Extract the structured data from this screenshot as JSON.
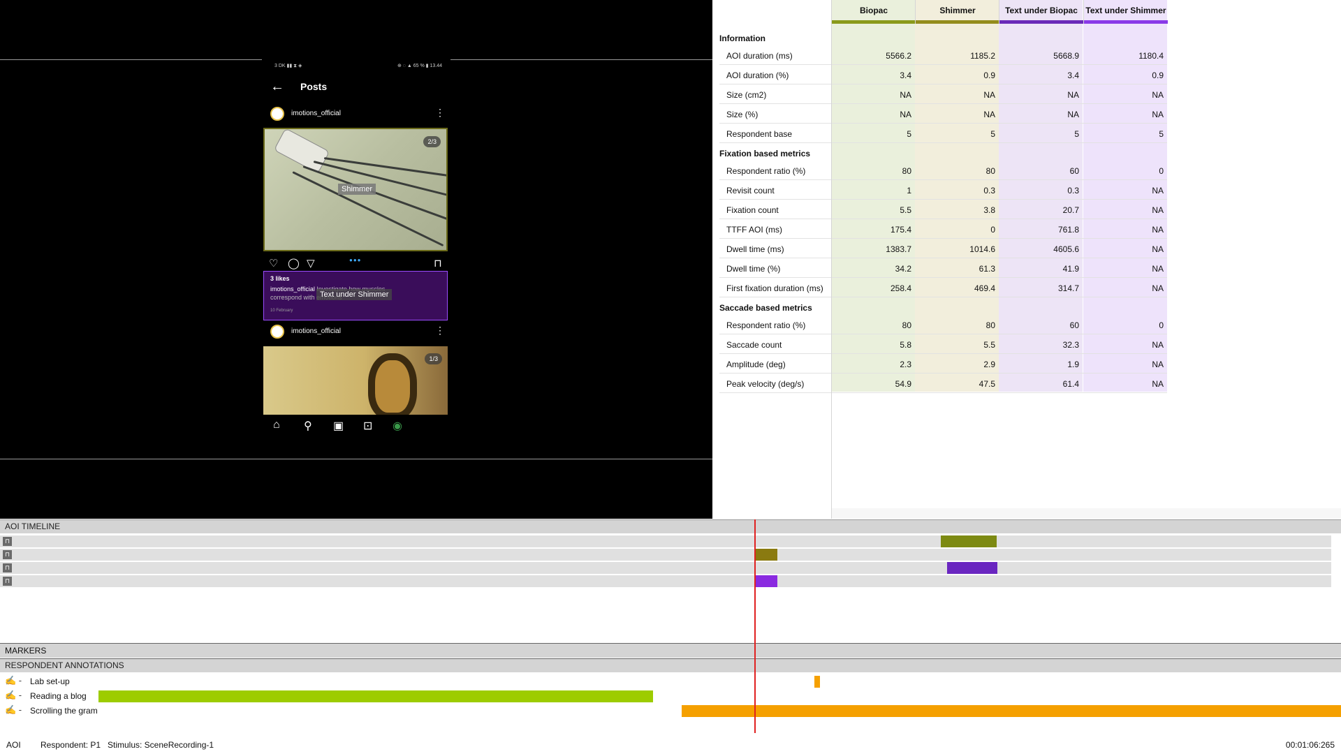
{
  "phone": {
    "status_left": "3 DK ▮▮ ⧗ ◈",
    "status_right": "⊕ ◌ ▲ 65 % ▮ 13.44",
    "header_title": "Posts",
    "posts": [
      {
        "username": "imotions_official",
        "counter": "2/3",
        "aoi_label": "Shimmer"
      },
      {
        "username": "imotions_official",
        "counter": "1/3"
      }
    ],
    "likes": "3 likes",
    "caption_user": "imotions_official",
    "caption_text": " Investigate how muscles correspond with emotions",
    "caption_date": "10 February",
    "caption_aoi_label": "Text under Shimmer"
  },
  "table": {
    "columns": [
      "Biopac",
      "Shimmer",
      "Text under Biopac",
      "Text under Shimmer"
    ],
    "column_colors": [
      "#8a9a1a",
      "#948c1c",
      "#6a2ab8",
      "#8a3ae8"
    ],
    "column_bg": [
      "#eaf0dc",
      "#f2eedc",
      "#ede4f6",
      "#eee3fb"
    ],
    "sections": [
      {
        "title": "Information",
        "rows": [
          {
            "label": "AOI duration (ms)",
            "values": [
              "5566.2",
              "1185.2",
              "5668.9",
              "1180.4"
            ]
          },
          {
            "label": "AOI duration (%)",
            "values": [
              "3.4",
              "0.9",
              "3.4",
              "0.9"
            ]
          },
          {
            "label": "Size (cm2)",
            "values": [
              "NA",
              "NA",
              "NA",
              "NA"
            ]
          },
          {
            "label": "Size (%)",
            "values": [
              "NA",
              "NA",
              "NA",
              "NA"
            ]
          },
          {
            "label": "Respondent base",
            "values": [
              "5",
              "5",
              "5",
              "5"
            ]
          }
        ]
      },
      {
        "title": "Fixation based metrics",
        "rows": [
          {
            "label": "Respondent ratio (%)",
            "values": [
              "80",
              "80",
              "60",
              "0"
            ]
          },
          {
            "label": "Revisit count",
            "values": [
              "1",
              "0.3",
              "0.3",
              "NA"
            ]
          },
          {
            "label": "Fixation count",
            "values": [
              "5.5",
              "3.8",
              "20.7",
              "NA"
            ]
          },
          {
            "label": "TTFF AOI (ms)",
            "values": [
              "175.4",
              "0",
              "761.8",
              "NA"
            ]
          },
          {
            "label": "Dwell time (ms)",
            "values": [
              "1383.7",
              "1014.6",
              "4605.6",
              "NA"
            ]
          },
          {
            "label": "Dwell time (%)",
            "values": [
              "34.2",
              "61.3",
              "41.9",
              "NA"
            ]
          },
          {
            "label": "First fixation duration (ms)",
            "values": [
              "258.4",
              "469.4",
              "314.7",
              "NA"
            ]
          }
        ]
      },
      {
        "title": "Saccade based metrics",
        "rows": [
          {
            "label": "Respondent ratio (%)",
            "values": [
              "80",
              "80",
              "60",
              "0"
            ]
          },
          {
            "label": "Saccade count",
            "values": [
              "5.8",
              "5.5",
              "32.3",
              "NA"
            ]
          },
          {
            "label": "Amplitude (deg)",
            "values": [
              "2.3",
              "2.9",
              "1.9",
              "NA"
            ]
          },
          {
            "label": "Peak velocity (deg/s)",
            "values": [
              "54.9",
              "47.5",
              "61.4",
              "NA"
            ]
          }
        ]
      }
    ]
  },
  "aoi_timeline": {
    "title": "AOI TIMELINE",
    "rows": [
      {
        "color": "#7d8a12",
        "segments": [
          [
            0.7015,
            0.743
          ]
        ]
      },
      {
        "color": "#8a7a10",
        "segments": [
          [
            0.5635,
            0.5795
          ]
        ]
      },
      {
        "color": "#6a26c0",
        "segments": [
          [
            0.7065,
            0.7435
          ]
        ]
      },
      {
        "color": "#8a2ae0",
        "segments": [
          [
            0.5635,
            0.5795
          ]
        ]
      }
    ]
  },
  "markers": {
    "title": "MARKERS"
  },
  "annotations": {
    "title": "RESPONDENT ANNOTATIONS",
    "rows": [
      {
        "label": "Lab set-up",
        "color": "#f5a000",
        "segments": [
          [
            0.6075,
            0.6115
          ]
        ]
      },
      {
        "label": "Reading a blog",
        "color": "#9dcc00",
        "segments": [
          [
            0.0735,
            0.487
          ]
        ]
      },
      {
        "label": "Scrolling the gram",
        "color": "#f5a000",
        "segments": [
          [
            0.5085,
            1.0
          ]
        ]
      }
    ]
  },
  "playhead_position": 0.5625,
  "status": {
    "mode": "AOI",
    "respondent": "Respondent: P1",
    "stimulus": "Stimulus: SceneRecording-1",
    "time": "00:01:06:265"
  }
}
